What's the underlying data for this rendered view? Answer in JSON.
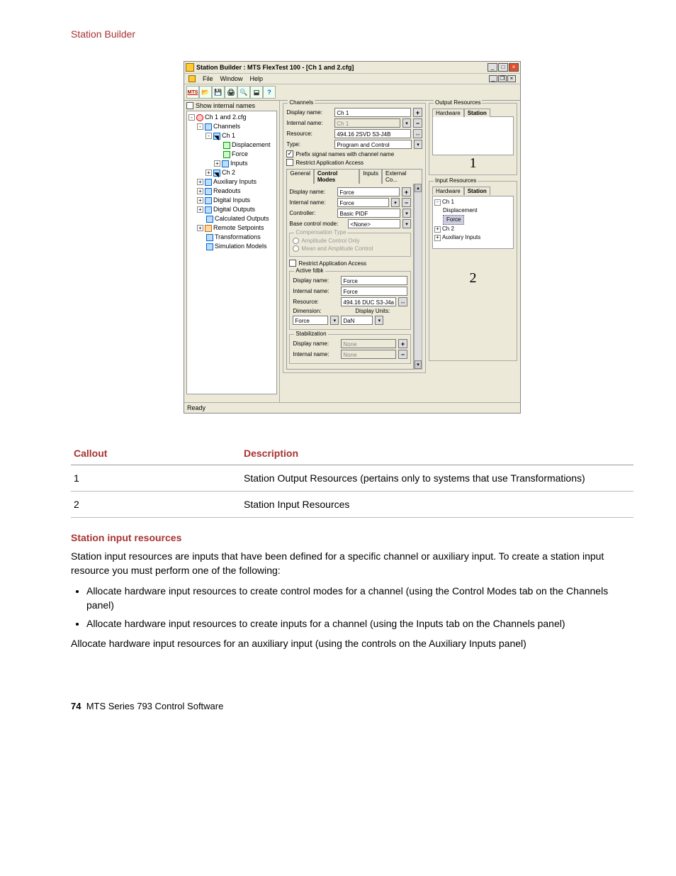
{
  "doc": {
    "header": "Station Builder",
    "page_num": "74",
    "footer_text": "MTS Series 793 Control Software"
  },
  "screenshot": {
    "title": "Station Builder : MTS FlexTest 100 - [Ch 1 and 2.cfg]",
    "menu": {
      "file": "File",
      "window": "Window",
      "help": "Help"
    },
    "show_internal": "Show internal names",
    "tree": {
      "root": "Ch 1 and 2.cfg",
      "channels": "Channels",
      "ch1": "Ch 1",
      "displacement": "Displacement",
      "force": "Force",
      "inputs": "Inputs",
      "ch2": "Ch 2",
      "aux": "Auxiliary Inputs",
      "readouts": "Readouts",
      "din": "Digital Inputs",
      "dout": "Digital Outputs",
      "calc": "Calculated Outputs",
      "remote": "Remote Setpoints",
      "trans": "Transformations",
      "sim": "Simulation Models"
    },
    "channels_panel": {
      "title": "Channels",
      "display_name": "Display name:",
      "display_name_val": "Ch 1",
      "internal_name": "Internal name:",
      "internal_name_val": "Ch 1",
      "resource": "Resource:",
      "resource_val": "494.16 2SVD S3-J4B",
      "type": "Type:",
      "type_val": "Program and Control",
      "prefix_cb": "Prefix signal names with channel name",
      "restrict_cb": "Restrict Application Access",
      "tabs": {
        "general": "General",
        "cm": "Control Modes",
        "inputs": "Inputs",
        "ext": "External Co..."
      },
      "cm_display": "Force",
      "cm_internal": "Force",
      "controller": "Controller:",
      "controller_val": "Basic PIDF",
      "base_mode": "Base control mode:",
      "base_mode_val": "<None>",
      "comp_type": "Compensation Type",
      "amp_only": "Amplitude Control Only",
      "mean_amp": "Mean and Amplitude Control",
      "restrict2": "Restrict Application Access",
      "active_fdbk": "Active fdbk",
      "af_display": "Force",
      "af_internal": "Force",
      "af_resource": "494.16 DUC S3-J4a",
      "dimension": "Dimension:",
      "dim_val": "Force",
      "units": "Display Units:",
      "units_val": "DaN",
      "stabilization": "Stabilization",
      "stab_display": "None",
      "stab_internal": "None"
    },
    "output_res": {
      "title": "Output Resources",
      "hw": "Hardware",
      "station": "Station",
      "callout": "1"
    },
    "input_res": {
      "title": "Input Resources",
      "hw": "Hardware",
      "station": "Station",
      "ch1": "Ch 1",
      "disp": "Displacement",
      "force": "Force",
      "ch2": "Ch 2",
      "aux": "Auxiliary Inputs",
      "callout": "2"
    },
    "status": "Ready"
  },
  "table": {
    "h1": "Callout",
    "h2": "Description",
    "r1c1": "1",
    "r1c2": "Station Output Resources (pertains only to systems that use Transformations)",
    "r2c1": "2",
    "r2c2": "Station Input Resources"
  },
  "section": {
    "title": "Station input resources",
    "p1": "Station input resources are inputs that have been defined for a specific channel or auxiliary input. To create a station input resource you must perform one of the following:",
    "li1": "Allocate hardware input resources to create control modes for a channel (using the Control Modes tab on the Channels panel)",
    "li2": "Allocate hardware input resources to create inputs for a channel (using the Inputs tab on the Channels panel)",
    "p2": "Allocate hardware input resources for an auxiliary input (using the controls on the Auxiliary Inputs panel)"
  }
}
